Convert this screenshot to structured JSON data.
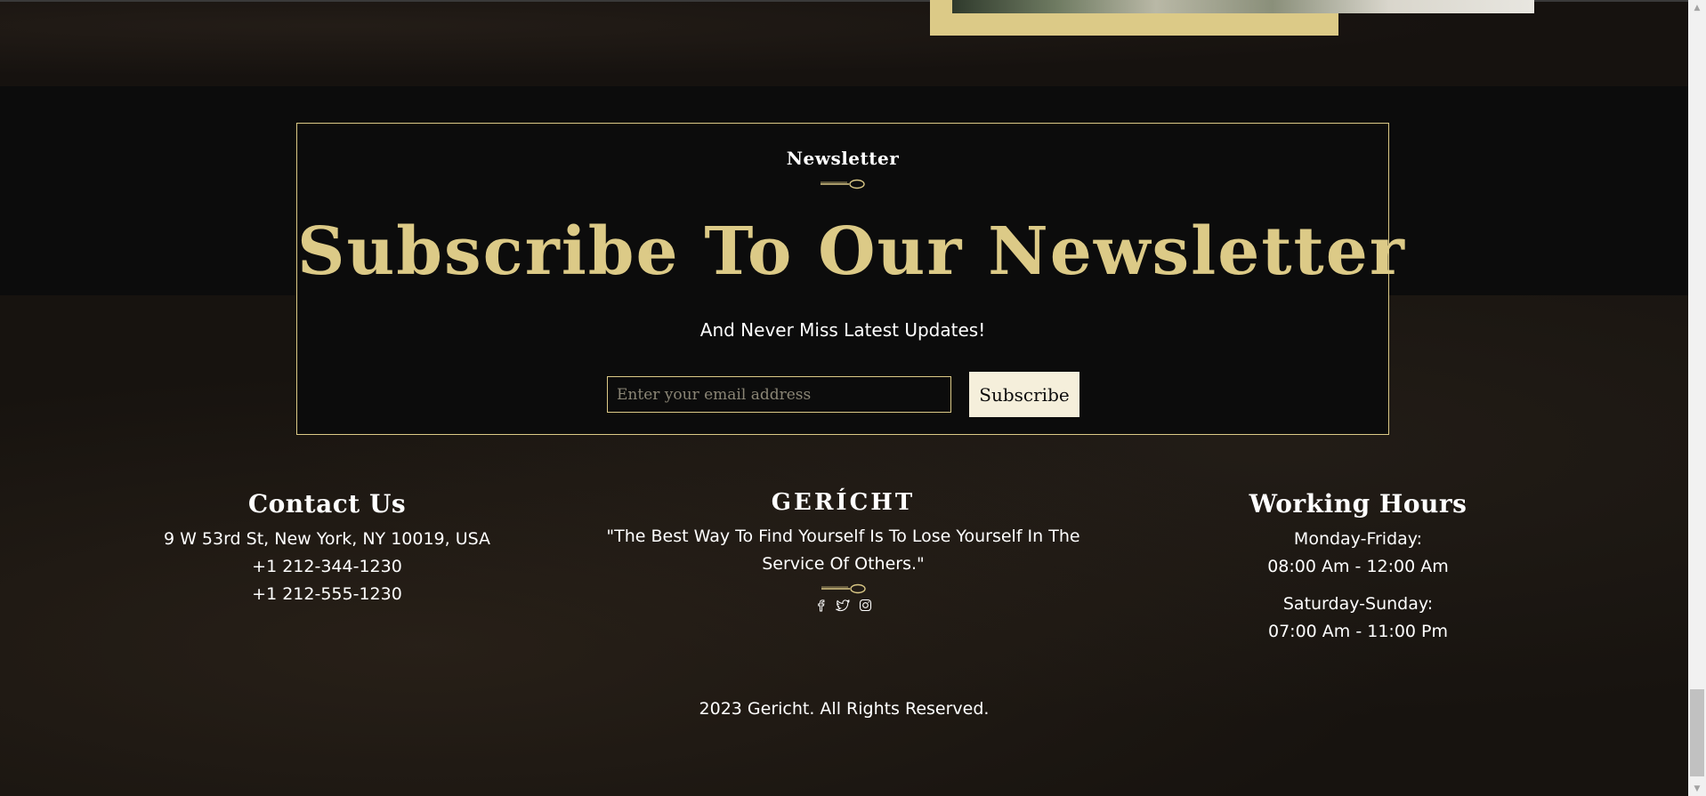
{
  "newsletter": {
    "subtitle": "Newsletter",
    "title": "Subscribe To Our Newsletter",
    "tagline": "And Never Miss Latest Updates!",
    "email_placeholder": "Enter your email address",
    "subscribe_label": "Subscribe"
  },
  "footer": {
    "contact": {
      "heading": "Contact Us",
      "lines": [
        "9 W 53rd St, New York, NY 10019, USA",
        "+1 212-344-1230",
        "+1 212-555-1230"
      ]
    },
    "brand": {
      "name": "GERÍCHT",
      "quote": "\"The Best Way To Find Yourself Is To Lose Yourself In The Service Of Others.\"",
      "socials": [
        "facebook-icon",
        "twitter-icon",
        "instagram-icon"
      ]
    },
    "hours": {
      "heading": "Working Hours",
      "weekday_label": "Monday-Friday:",
      "weekday_hours": "08:00 Am - 12:00 Am",
      "weekend_label": "Saturday-Sunday:",
      "weekend_hours": "07:00 Am - 11:00 Pm"
    },
    "copyright": "2023 Gericht. All Rights Reserved."
  },
  "colors": {
    "accent_gold": "#dcca87",
    "background": "#0c0c0c",
    "button_bg": "#f5efdb",
    "text": "#ffffff"
  }
}
